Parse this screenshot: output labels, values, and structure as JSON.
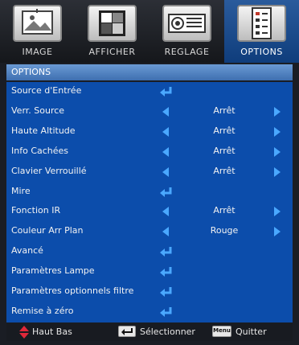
{
  "tabs": [
    {
      "label": "IMAGE",
      "icon": "image-icon",
      "active": false
    },
    {
      "label": "AFFICHER",
      "icon": "display-icon",
      "active": false
    },
    {
      "label": "REGLAGE",
      "icon": "projector-icon",
      "active": false
    },
    {
      "label": "OPTIONS",
      "icon": "options-icon",
      "active": true
    }
  ],
  "section_title": "OPTIONS",
  "rows": [
    {
      "label": "Source d'Entrée",
      "control": "enter"
    },
    {
      "label": "Verr. Source",
      "control": "select",
      "value": "Arrêt"
    },
    {
      "label": "Haute Altitude",
      "control": "select",
      "value": "Arrêt"
    },
    {
      "label": "Info Cachées",
      "control": "select",
      "value": "Arrêt"
    },
    {
      "label": "Clavier Verrouillé",
      "control": "select",
      "value": "Arrêt"
    },
    {
      "label": "Mire",
      "control": "enter"
    },
    {
      "label": "Fonction IR",
      "control": "select",
      "value": "Arrêt"
    },
    {
      "label": "Couleur Arr Plan",
      "control": "select",
      "value": "Rouge"
    },
    {
      "label": "Avancé",
      "control": "enter"
    },
    {
      "label": "Paramètres Lampe",
      "control": "enter"
    },
    {
      "label": "Paramètres optionnels filtre",
      "control": "enter"
    },
    {
      "label": "Remise à zéro",
      "control": "enter"
    }
  ],
  "footer": {
    "navigate_label": "Haut Bas",
    "select_label": "Sélectionner",
    "menu_key": "Menu",
    "quit_label": "Quitter"
  },
  "colors": {
    "accent": "#4aa8ff",
    "menu_bg": "#0c4dab",
    "active_tab": "#1f4f92",
    "updown": "#e0283a"
  }
}
